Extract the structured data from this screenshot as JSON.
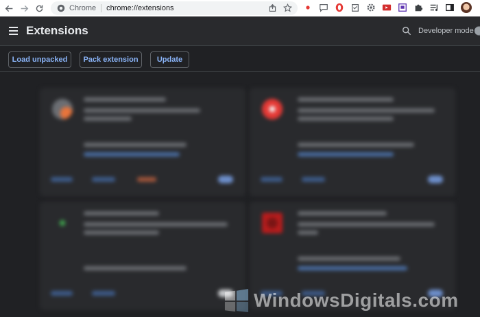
{
  "browser": {
    "site_chip": "Chrome",
    "url": "chrome://extensions",
    "toolbar_extensions": [
      "red-dot-icon",
      "chat-icon",
      "opera-icon",
      "clipboard-icon",
      "gear-icon",
      "record-icon",
      "window-icon",
      "puzzle-icon",
      "media-queue-icon",
      "side-panel-icon",
      "avatar"
    ]
  },
  "header": {
    "title": "Extensions",
    "developer_mode_label": "Developer mode"
  },
  "actions": {
    "load_unpacked": "Load unpacked",
    "pack_extension": "Pack extension",
    "update": "Update"
  },
  "watermark": {
    "text": "WindowsDigitals.com"
  },
  "colors": {
    "page_bg": "#202124",
    "header_bg": "#292a2d",
    "accent": "#8ab4f8"
  }
}
